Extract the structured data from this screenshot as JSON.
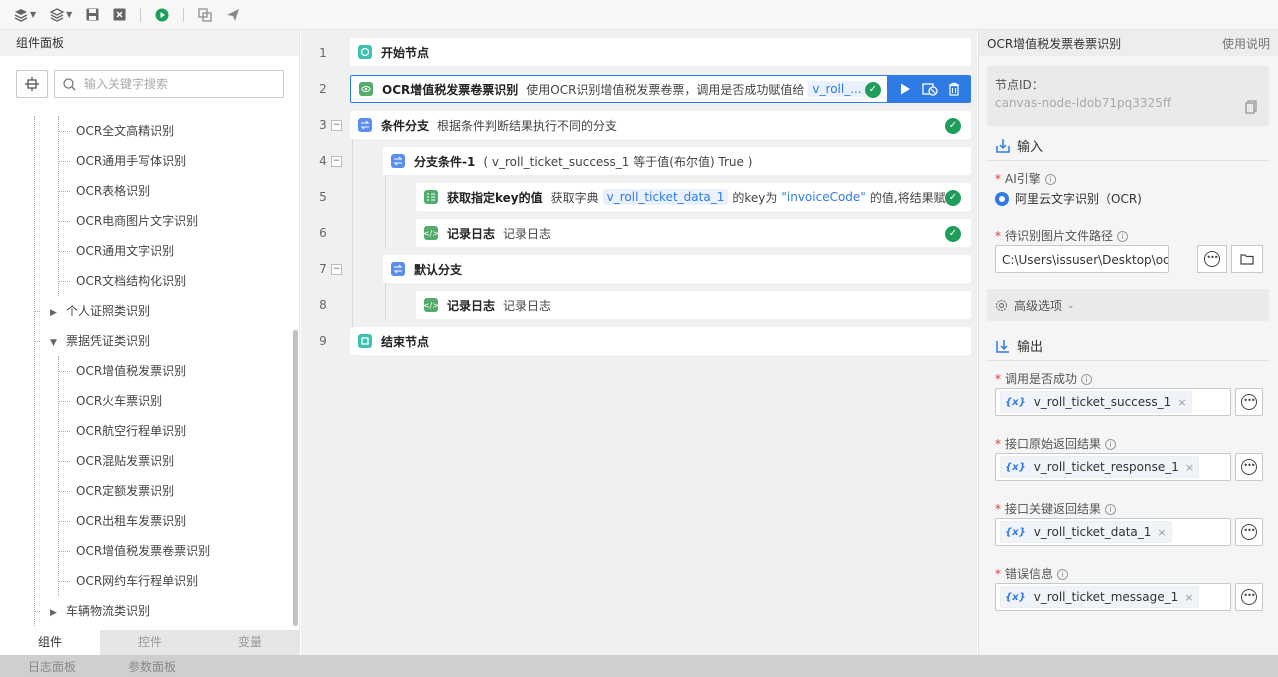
{
  "left_panel": {
    "title": "组件面板",
    "search_placeholder": "输入关键字搜索",
    "tree": [
      {
        "label": "OCR全文高精识别",
        "level": 2
      },
      {
        "label": "OCR通用手写体识别",
        "level": 2
      },
      {
        "label": "OCR表格识别",
        "level": 2
      },
      {
        "label": "OCR电商图片文字识别",
        "level": 2
      },
      {
        "label": "OCR通用文字识别",
        "level": 2
      },
      {
        "label": "OCR文档结构化识别",
        "level": 2
      },
      {
        "label": "个人证照类识别",
        "level": 1,
        "state": "collapsed"
      },
      {
        "label": "票据凭证类识别",
        "level": 1,
        "state": "expanded"
      },
      {
        "label": "OCR增值税发票识别",
        "level": 2
      },
      {
        "label": "OCR火车票识别",
        "level": 2
      },
      {
        "label": "OCR航空行程单识别",
        "level": 2
      },
      {
        "label": "OCR混贴发票识别",
        "level": 2
      },
      {
        "label": "OCR定额发票识别",
        "level": 2
      },
      {
        "label": "OCR出租车发票识别",
        "level": 2
      },
      {
        "label": "OCR增值税发票卷票识别",
        "level": 2
      },
      {
        "label": "OCR网约车行程单识别",
        "level": 2
      },
      {
        "label": "车辆物流类识别",
        "level": 1,
        "state": "collapsed"
      }
    ],
    "tabs": [
      "组件",
      "控件",
      "变量"
    ]
  },
  "bottom_bar": {
    "log_panel": "日志面板",
    "param_panel": "参数面板"
  },
  "flow": {
    "rows": [
      {
        "num": "1",
        "title": "开始节点",
        "desc": ""
      },
      {
        "num": "2",
        "title": "OCR增值税发票卷票识别",
        "desc": "使用OCR识别增值税发票卷票，调用是否成功赋值给",
        "chip": "v_roll_..."
      },
      {
        "num": "3",
        "title": "条件分支",
        "desc": "根据条件判断结果执行不同的分支"
      },
      {
        "num": "4",
        "title": "分支条件-1",
        "desc": "( v_roll_ticket_success_1 等于值(布尔值) True )"
      },
      {
        "num": "5",
        "title": "获取指定key的值",
        "desc_pre": "获取字典",
        "chip": "v_roll_ticket_data_1",
        "desc_mid": "的key为",
        "str": "\"invoiceCode\"",
        "desc_post": "的值,将结果赋..."
      },
      {
        "num": "6",
        "title": "记录日志",
        "desc": "记录日志"
      },
      {
        "num": "7",
        "title": "默认分支",
        "desc": ""
      },
      {
        "num": "8",
        "title": "记录日志",
        "desc": "记录日志"
      },
      {
        "num": "9",
        "title": "结束节点",
        "desc": ""
      }
    ]
  },
  "right_panel": {
    "title": "OCR增值税发票卷票识别",
    "help": "使用说明",
    "node_id_label": "节点ID：",
    "node_id_value": "canvas-node-ldob71pq3325ff",
    "input_title": "输入",
    "ai_engine_label": "AI引擎",
    "ai_engine_value": "阿里云文字识别（OCR)",
    "path_label": "待识别图片文件路径",
    "path_value": "C:\\Users\\issuser\\Desktop\\ocr图片",
    "advanced_label": "高级选项",
    "output_title": "输出",
    "outputs": [
      {
        "label": "调用是否成功",
        "value": "v_roll_ticket_success_1"
      },
      {
        "label": "接口原始返回结果",
        "value": "v_roll_ticket_response_1"
      },
      {
        "label": "接口关键返回结果",
        "value": "v_roll_ticket_data_1"
      },
      {
        "label": "错误信息",
        "value": "v_roll_ticket_message_1"
      }
    ]
  },
  "colors": {
    "accent": "#2e7be6",
    "success": "#1e9e5a",
    "teal": "#3cc1b2",
    "green": "#52ad6c",
    "blue": "#5a8ef0"
  }
}
